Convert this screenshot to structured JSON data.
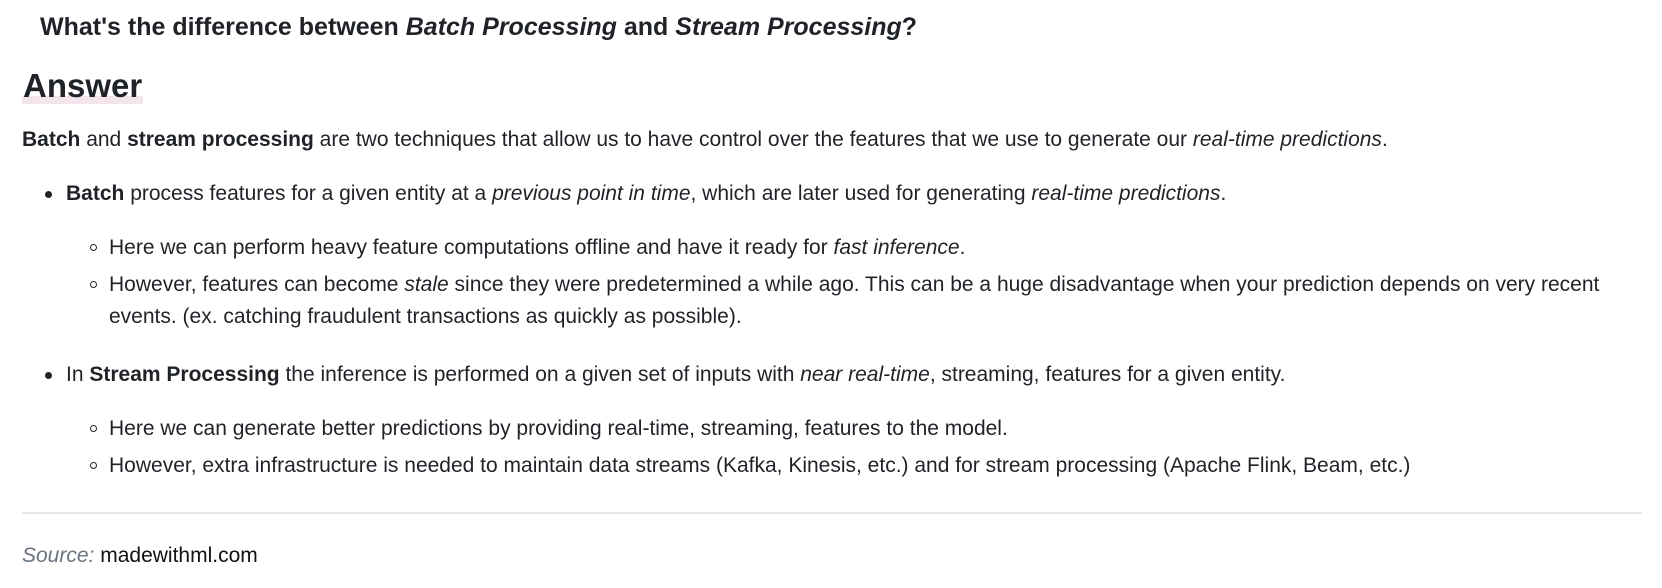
{
  "question": {
    "part1": "What's the difference between ",
    "term1": "Batch Processing",
    "part2": " and ",
    "term2": "Stream Processing",
    "part3": "?"
  },
  "answer_heading": "Answer",
  "intro": {
    "b1": "Batch",
    "t1": " and ",
    "b2": "stream processing",
    "t2": " are two techniques that allow us to have control over the features that we use to generate our ",
    "i1": "real-time predictions",
    "t3": "."
  },
  "batch": {
    "b1": "Batch",
    "t1": " process features for a given entity at a ",
    "i1": "previous point in time",
    "t2": ", which are later used for generating ",
    "i2": "real-time predictions",
    "t3": ".",
    "sub1": {
      "t1": "Here we can perform heavy feature computations offline and have it ready for ",
      "i1": "fast inference",
      "t2": "."
    },
    "sub2": {
      "t1": "However, features can become ",
      "i1": "stale",
      "t2": " since they were predetermined a while ago. This can be a huge disadvantage when your prediction depends on very recent events. (ex. catching fraudulent transactions as quickly as possible)."
    }
  },
  "stream": {
    "t0": "In ",
    "b1": "Stream Processing",
    "t1": " the inference is performed on a given set of inputs with ",
    "i1": "near real-time",
    "t2": ", streaming, features for a given entity.",
    "sub1": "Here we can generate better predictions by providing real-time, streaming, features to the model.",
    "sub2": "However, extra infrastructure is needed to maintain data streams (Kafka, Kinesis, etc.) and for stream processing (Apache Flink, Beam, etc.)"
  },
  "source": {
    "label": "Source:",
    "link": "madewithml.com"
  }
}
